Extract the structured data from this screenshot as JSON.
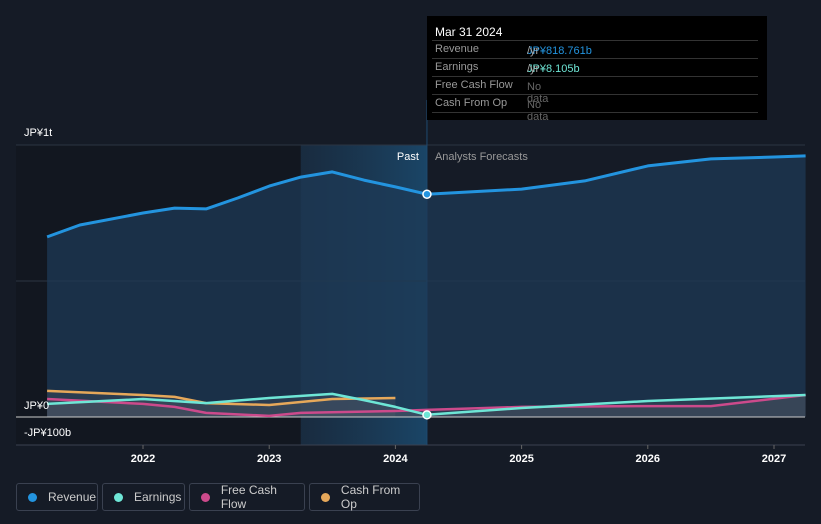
{
  "tooltip": {
    "date": "Mar 31 2024",
    "rows": [
      {
        "label": "Revenue",
        "value": "JP¥818.761b",
        "unit": " /yr",
        "color": "#2394df"
      },
      {
        "label": "Earnings",
        "value": "JP¥8.105b",
        "unit": " /yr",
        "color": "#6ee6d6"
      },
      {
        "label": "Free Cash Flow",
        "value": "No data",
        "unit": "",
        "color": "#666"
      },
      {
        "label": "Cash From Op",
        "value": "No data",
        "unit": "",
        "color": "#666"
      }
    ]
  },
  "chart_data": {
    "type": "line",
    "y_labels": {
      "top": "JP¥1t",
      "zero": "JP¥0",
      "neg": "-JP¥100b"
    },
    "ylim": [
      -100,
      1000
    ],
    "xlim": [
      2021.0,
      2027.25
    ],
    "x_ticks": [
      2022,
      2023,
      2024,
      2025,
      2026,
      2027
    ],
    "past_label": "Past",
    "forecast_label": "Analysts Forecasts",
    "past_start": 2023.25,
    "divider": 2024.25,
    "series": [
      {
        "name": "Revenue",
        "color": "#2394df",
        "area": true,
        "points": [
          [
            2021.24,
            662
          ],
          [
            2021.5,
            706
          ],
          [
            2022,
            750
          ],
          [
            2022.25,
            768
          ],
          [
            2022.5,
            765
          ],
          [
            2022.75,
            805
          ],
          [
            2023,
            849
          ],
          [
            2023.25,
            882
          ],
          [
            2023.5,
            901
          ],
          [
            2023.75,
            871
          ],
          [
            2024,
            846
          ],
          [
            2024.25,
            819
          ],
          [
            2025,
            838
          ],
          [
            2025.5,
            868
          ],
          [
            2026,
            923
          ],
          [
            2026.5,
            949
          ],
          [
            2027,
            956
          ],
          [
            2027.25,
            960
          ]
        ]
      },
      {
        "name": "Earnings",
        "color": "#6ee6d6",
        "points": [
          [
            2021.24,
            48
          ],
          [
            2022,
            66
          ],
          [
            2022.5,
            51
          ],
          [
            2023,
            70
          ],
          [
            2023.5,
            85
          ],
          [
            2023.75,
            62
          ],
          [
            2024,
            37
          ],
          [
            2024.25,
            8
          ],
          [
            2025,
            33
          ],
          [
            2026,
            59
          ],
          [
            2027.25,
            81
          ]
        ]
      },
      {
        "name": "Free Cash Flow",
        "color": "#cc4a8b",
        "points": [
          [
            2021.24,
            66
          ],
          [
            2022,
            48
          ],
          [
            2022.25,
            37
          ],
          [
            2022.5,
            15
          ],
          [
            2023,
            4
          ],
          [
            2023.25,
            15
          ],
          [
            2024,
            22
          ],
          [
            2024.25,
            26
          ],
          [
            2025,
            37
          ],
          [
            2026,
            40
          ],
          [
            2026.5,
            40
          ],
          [
            2027.25,
            81
          ]
        ]
      },
      {
        "name": "Cash From Op",
        "color": "#e6a85a",
        "points": [
          [
            2021.24,
            96
          ],
          [
            2022,
            81
          ],
          [
            2022.25,
            74
          ],
          [
            2022.5,
            51
          ],
          [
            2023,
            44
          ],
          [
            2023.5,
            66
          ],
          [
            2024,
            70
          ]
        ]
      }
    ]
  }
}
